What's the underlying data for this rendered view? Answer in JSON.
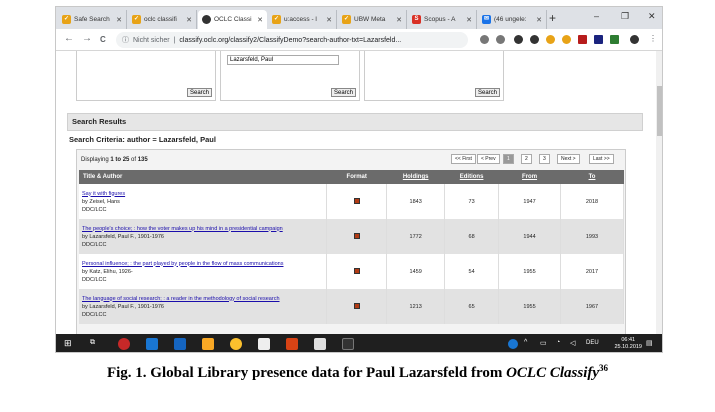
{
  "browser": {
    "tabs": [
      {
        "label": "Safe Search",
        "icon_color": "#e8a317"
      },
      {
        "label": "oclc classifi",
        "icon_color": "#e8a317"
      },
      {
        "label": "OCLC Classi",
        "icon_color": "#333333",
        "active": true
      },
      {
        "label": "u:access - l",
        "icon_color": "#e8a317"
      },
      {
        "label": "UBW Meta",
        "icon_color": "#e8a317"
      },
      {
        "label": "Scopus - A",
        "icon_color": "#d93025"
      },
      {
        "label": "(46 ungele:",
        "icon_color": "#1a73e8"
      }
    ],
    "new_tab": "+",
    "window_min": "–",
    "window_max": "❐",
    "window_close": "✕",
    "back": "←",
    "forward": "→",
    "reload": "C",
    "security": "Nicht sicher",
    "url": "classify.oclc.org/classify2/ClassifyDemo?search-author-txt=Lazarsfeld..."
  },
  "search_form": {
    "author_value": "Lazarsfeld, Paul",
    "button": "Search"
  },
  "results": {
    "header": "Search Results",
    "criteria": "Search Criteria: author = Lazarsfeld, Paul",
    "displaying_prefix": "Displaying ",
    "range": "1 to 25",
    "of_label": " of ",
    "total": "135",
    "pager": {
      "first": "<< First",
      "prev": "< Prev",
      "pages": [
        "1",
        "2",
        "3"
      ],
      "next": "Next >",
      "last": "Last >>"
    },
    "columns": {
      "title": "Title & Author",
      "format": "Format",
      "holdings": "Holdings",
      "editions": "Editions",
      "from": "From",
      "to": "To"
    },
    "rows": [
      {
        "title": "Say it with figures",
        "author": "by Zeisel, Hans",
        "class": "DDC/LCC",
        "holdings": "1843",
        "editions": "73",
        "from": "1947",
        "to": "2018"
      },
      {
        "title": "The people's choice; : how the voter makes up his mind in a presidential campaign",
        "author": "by Lazarsfeld, Paul F., 1901-1976",
        "class": "DDC/LCC",
        "holdings": "1772",
        "editions": "68",
        "from": "1944",
        "to": "1993"
      },
      {
        "title": "Personal influence; : the part played by people in the flow of mass communications",
        "author": "by Katz, Elihu, 1926-",
        "class": "DDC/LCC",
        "holdings": "1459",
        "editions": "54",
        "from": "1955",
        "to": "2017"
      },
      {
        "title": "The language of social research; : a reader in the methodology of social research",
        "author": "by Lazarsfeld, Paul F., 1901-1976",
        "class": "DDC/LCC",
        "holdings": "1213",
        "editions": "65",
        "from": "1955",
        "to": "1967"
      }
    ]
  },
  "taskbar": {
    "language": "DEU",
    "time": "06:41",
    "date": "25.10.2019"
  },
  "caption": {
    "text": "Fig. 1. Global Library presence data for Paul Lazarsfeld from ",
    "italic": "OCLC Classify",
    "sup": "36"
  }
}
